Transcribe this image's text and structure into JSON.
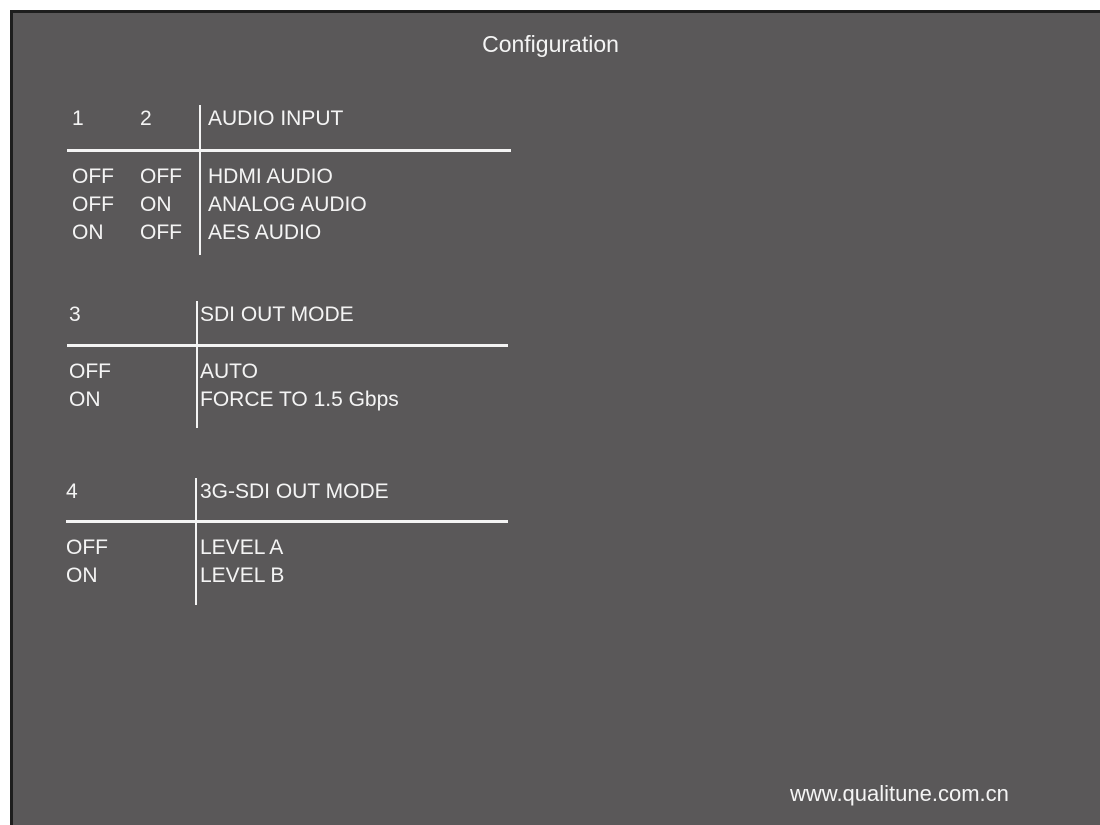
{
  "title": "Configuration",
  "tables": [
    {
      "switch_headers": [
        "1",
        "2"
      ],
      "mode_header": "AUDIO INPUT",
      "rows": [
        {
          "switches": [
            "OFF",
            "OFF"
          ],
          "mode": "HDMI AUDIO"
        },
        {
          "switches": [
            "OFF",
            "ON"
          ],
          "mode": "ANALOG AUDIO"
        },
        {
          "switches": [
            "ON",
            "OFF"
          ],
          "mode": "AES AUDIO"
        }
      ]
    },
    {
      "switch_headers": [
        "3"
      ],
      "mode_header": "SDI OUT MODE",
      "rows": [
        {
          "switches": [
            "OFF"
          ],
          "mode": "AUTO"
        },
        {
          "switches": [
            "ON"
          ],
          "mode": "FORCE TO 1.5 Gbps"
        }
      ]
    },
    {
      "switch_headers": [
        "4"
      ],
      "mode_header": "3G-SDI OUT MODE",
      "rows": [
        {
          "switches": [
            "OFF"
          ],
          "mode": "LEVEL A"
        },
        {
          "switches": [
            "ON"
          ],
          "mode": "LEVEL B"
        }
      ]
    }
  ],
  "website": "www.qualitune.com.cn"
}
